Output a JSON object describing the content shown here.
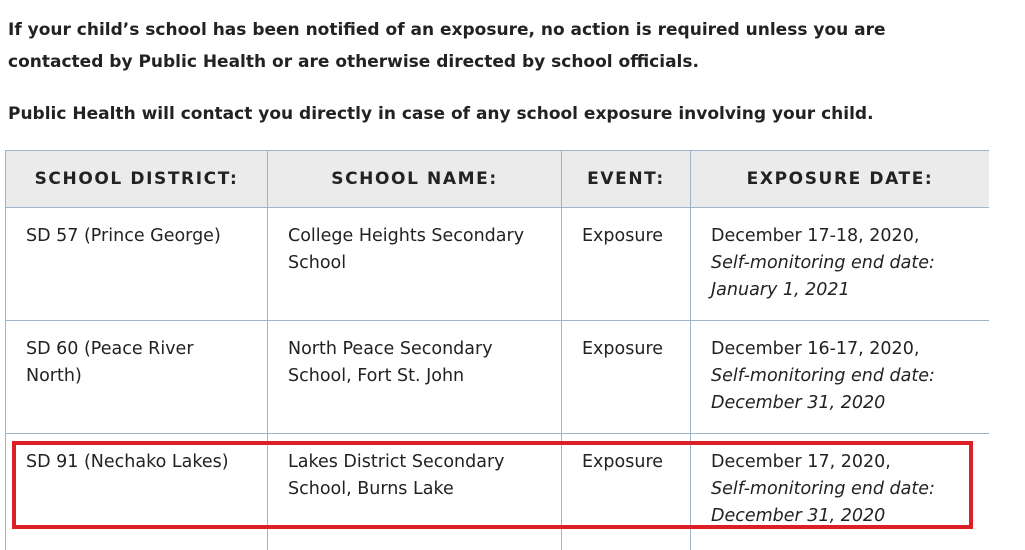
{
  "notice": {
    "line1": "If your child’s school has been notified of an exposure, no action is required unless you are",
    "line2": "contacted by Public Health or are otherwise directed by school officials.",
    "line3": "Public Health will contact you directly in case of any school exposure involving your child."
  },
  "table": {
    "headers": [
      "SCHOOL DISTRICT:",
      "SCHOOL NAME:",
      "EVENT:",
      "EXPOSURE DATE:"
    ],
    "rows": [
      {
        "district": "SD 57 (Prince George)",
        "school": "College Heights Secondary School",
        "event": "Exposure",
        "date": "December 17-18, 2020,",
        "end_label": "Self-monitoring end date:",
        "end_date": "January 1, 2021"
      },
      {
        "district": "SD 60 (Peace River North)",
        "school": "North Peace Secondary School, Fort St. John",
        "event": "Exposure",
        "date": "December 16-17, 2020,",
        "end_label": "Self-monitoring end date:",
        "end_date": "December 31, 2020"
      },
      {
        "district": "SD 91 (Nechako Lakes)",
        "school": "Lakes District Secondary School, Burns Lake",
        "event": "Exposure",
        "date": "December 17, 2020,",
        "end_label": "Self-monitoring end date:",
        "end_date": "December 31, 2020"
      }
    ]
  },
  "colors": {
    "highlight": "#dd1f26",
    "header_bg": "#ebebeb",
    "border": "#9db4cc"
  }
}
